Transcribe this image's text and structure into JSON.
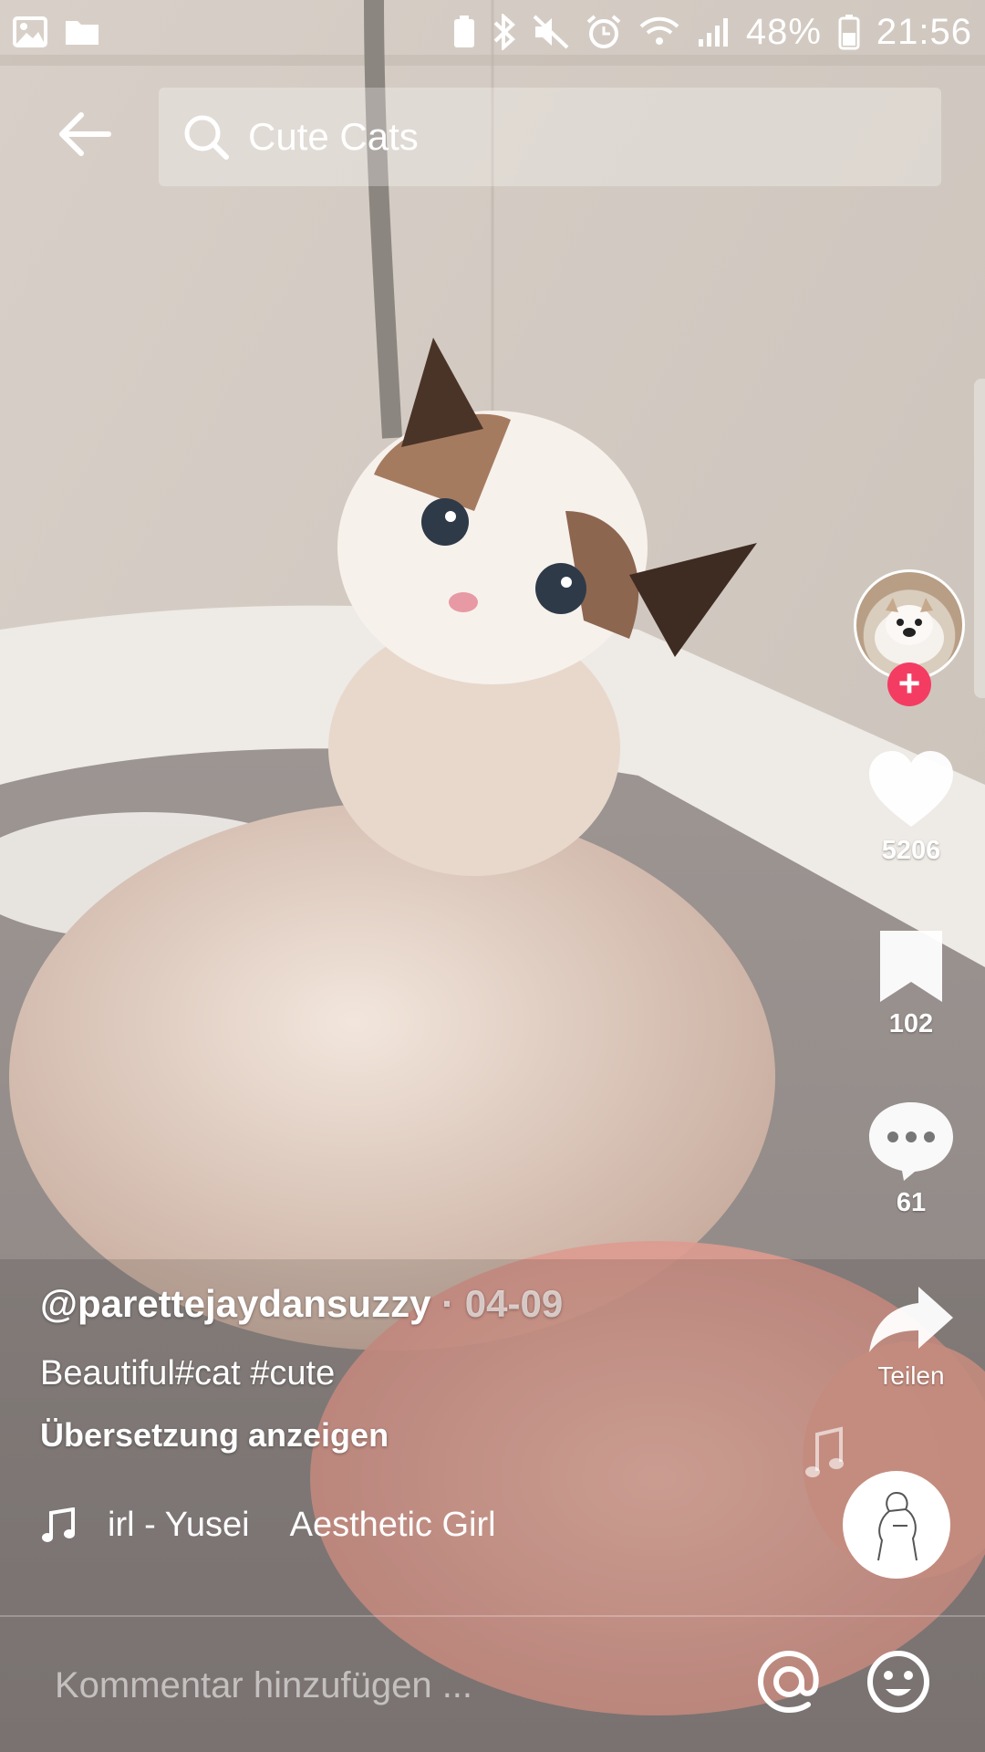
{
  "status_bar": {
    "battery": "48%",
    "time": "21:56",
    "icons": [
      "gallery-icon",
      "folder-icon",
      "battery-saver-icon",
      "bluetooth-icon",
      "mute-icon",
      "alarm-icon",
      "wifi-icon",
      "signal-icon",
      "battery-icon"
    ]
  },
  "header": {
    "back_icon": "arrow-left-icon",
    "search_query": "Cute Cats"
  },
  "actions": {
    "like_count": "5206",
    "favorites_count": "102",
    "comments_count": "61",
    "share_label": "Teilen"
  },
  "post": {
    "username": "@parettejaydansuzzy",
    "separator": " · ",
    "date": "04-09",
    "description": "Beautiful#cat #cute",
    "translate_label": "Übersetzung anzeigen",
    "music_track": "irl - Yusei",
    "music_title": "Aesthetic Girl"
  },
  "comment_bar": {
    "placeholder": "Kommentar hinzufügen ..."
  },
  "colors": {
    "follow_accent": "#f43c62",
    "icon": "#ffffff"
  }
}
